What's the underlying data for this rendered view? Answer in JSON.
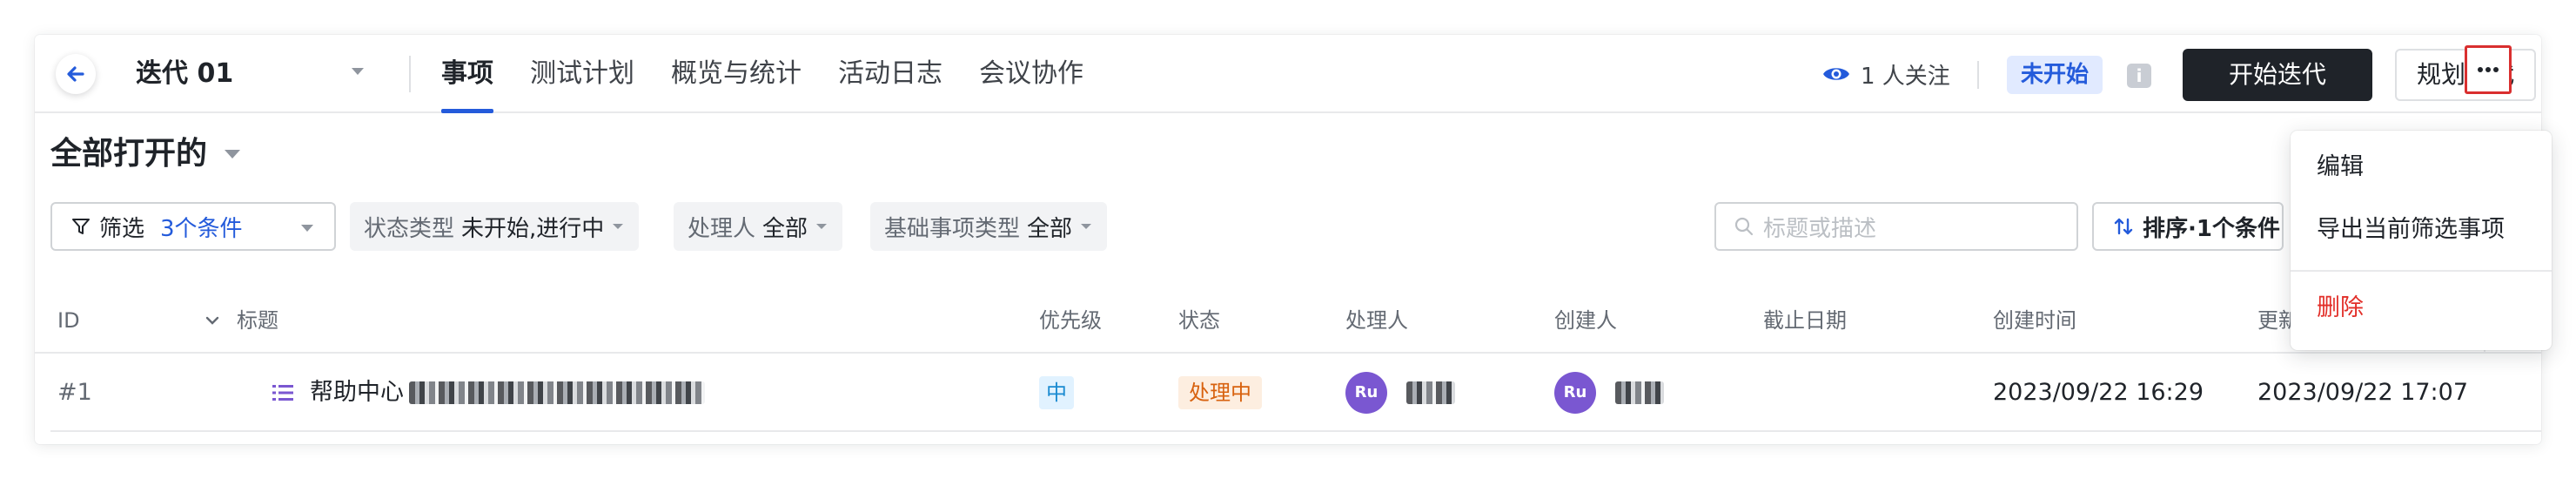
{
  "header": {
    "iteration_name": "迭代 01",
    "tabs": [
      {
        "label": "事项",
        "active": true
      },
      {
        "label": "测试计划",
        "active": false
      },
      {
        "label": "概览与统计",
        "active": false
      },
      {
        "label": "活动日志",
        "active": false
      },
      {
        "label": "会议协作",
        "active": false
      }
    ],
    "watchers": "1 人关注",
    "status_badge": "未开始",
    "info_icon": "i",
    "start_button": "开始迭代",
    "plan_button": "规划迭代"
  },
  "view": {
    "title": "全部打开的"
  },
  "filters": {
    "filter_label": "筛选",
    "filter_count": "3个条件",
    "chips": [
      {
        "key": "状态类型",
        "value": "未开始,进行中"
      },
      {
        "key": "处理人",
        "value": "全部"
      },
      {
        "key": "基础事项类型",
        "value": "全部"
      }
    ],
    "search_placeholder": "标题或描述",
    "sort_label": "排序·1个条件"
  },
  "table": {
    "columns": [
      "ID",
      "标题",
      "优先级",
      "状态",
      "处理人",
      "创建人",
      "截止日期",
      "创建时间",
      "更新时间"
    ],
    "rows": [
      {
        "id": "#1",
        "title": "帮助中心",
        "priority": "中",
        "state": "处理中",
        "assignee_avatar": "Ru",
        "creator_avatar": "Ru",
        "due_date": "",
        "created_at": "2023/09/22 16:29",
        "updated_at": "2023/09/22 17:07"
      }
    ]
  },
  "menu": {
    "items": [
      {
        "label": "编辑"
      },
      {
        "label": "导出当前筛选事项"
      },
      {
        "label": "删除",
        "danger": true
      }
    ]
  },
  "colors": {
    "accent": "#245bdb",
    "primary_button": "#1f2329",
    "danger": "#e22e28",
    "avatar": "#7a57d1",
    "highlight_border": "#d92f2f"
  },
  "icons": {
    "back": "arrow-left-icon",
    "watch": "eye-icon",
    "more": "more-horizontal-icon",
    "filter": "funnel-icon",
    "search": "search-icon",
    "sort": "sort-icon",
    "row_type": "list-icon",
    "settings": "settings-icon"
  }
}
